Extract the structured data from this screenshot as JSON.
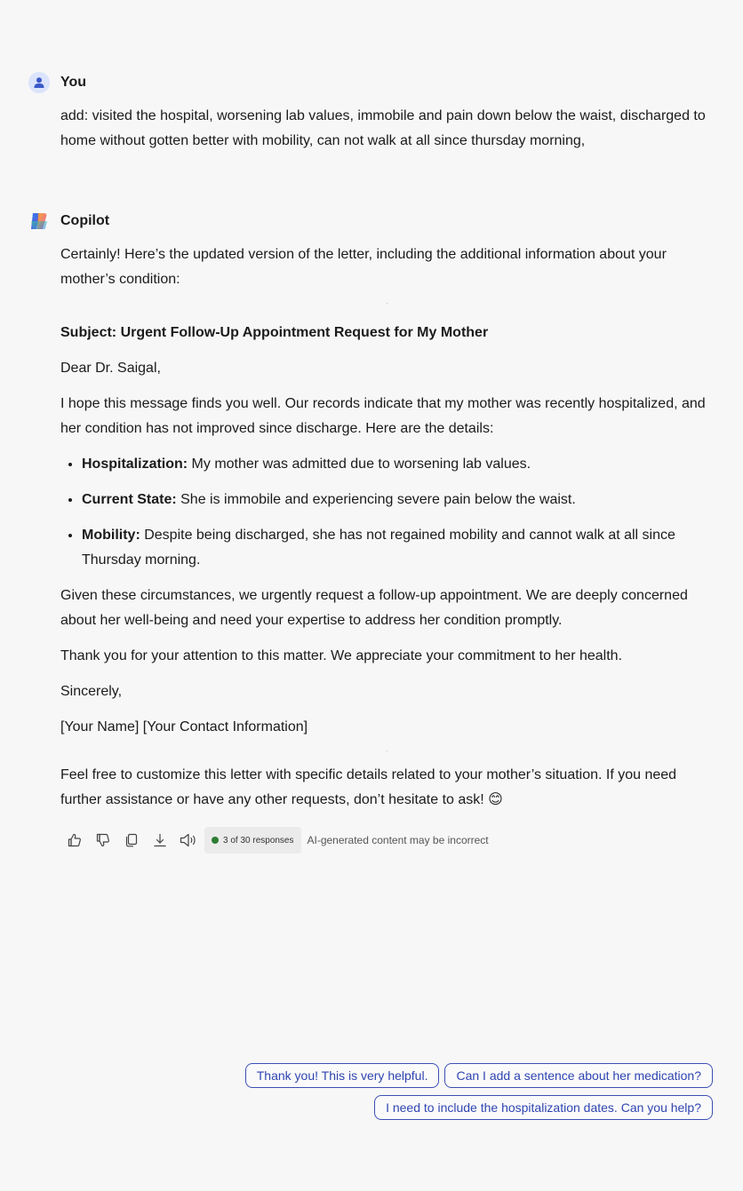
{
  "user_message": {
    "author": "You",
    "text": "add: visited the hospital, worsening lab values, immobile and pain down below the waist, discharged to home without gotten better with mobility, can not walk at all since thursday morning,"
  },
  "copilot_message": {
    "author": "Copilot",
    "intro": "Certainly! Here’s the updated version of the letter, including the additional information about your mother’s condition:",
    "subject": "Subject: Urgent Follow-Up Appointment Request for My Mother",
    "greeting": "Dear Dr. Saigal,",
    "paragraph1": "I hope this message finds you well. Our records indicate that my mother was recently hospitalized, and her condition has not improved since discharge. Here are the details:",
    "bullets": [
      {
        "label": "Hospitalization:",
        "text": " My mother was admitted due to worsening lab values."
      },
      {
        "label": "Current State:",
        "text": " She is immobile and experiencing severe pain below the waist."
      },
      {
        "label": "Mobility:",
        "text": " Despite being discharged, she has not regained mobility and cannot walk at all since Thursday morning."
      }
    ],
    "paragraph2": "Given these circumstances, we urgently request a follow-up appointment. We are deeply concerned about her well-being and need your expertise to address her condition promptly.",
    "paragraph3": "Thank you for your attention to this matter. We appreciate your commitment to her health.",
    "closing": "Sincerely,",
    "signature": "[Your Name] [Your Contact Information]",
    "outro": "Feel free to customize this letter with specific details related to your mother’s situation. If you need further assistance or have any other requests, don’t hesitate to ask! 😊"
  },
  "actions": {
    "icons": [
      "thumbs-up-icon",
      "thumbs-down-icon",
      "copy-icon",
      "download-icon",
      "read-aloud-icon"
    ],
    "responses_badge": "3 of 30 responses",
    "disclaimer": "AI-generated content may be incorrect"
  },
  "suggestions": [
    "Thank you! This is very helpful.",
    "Can I add a sentence about her medication?",
    "I need to include the hospitalization dates. Can you help?"
  ],
  "colors": {
    "background": "#f7f7f7",
    "accent": "#2f45b0",
    "status_dot": "#2e7d32"
  }
}
